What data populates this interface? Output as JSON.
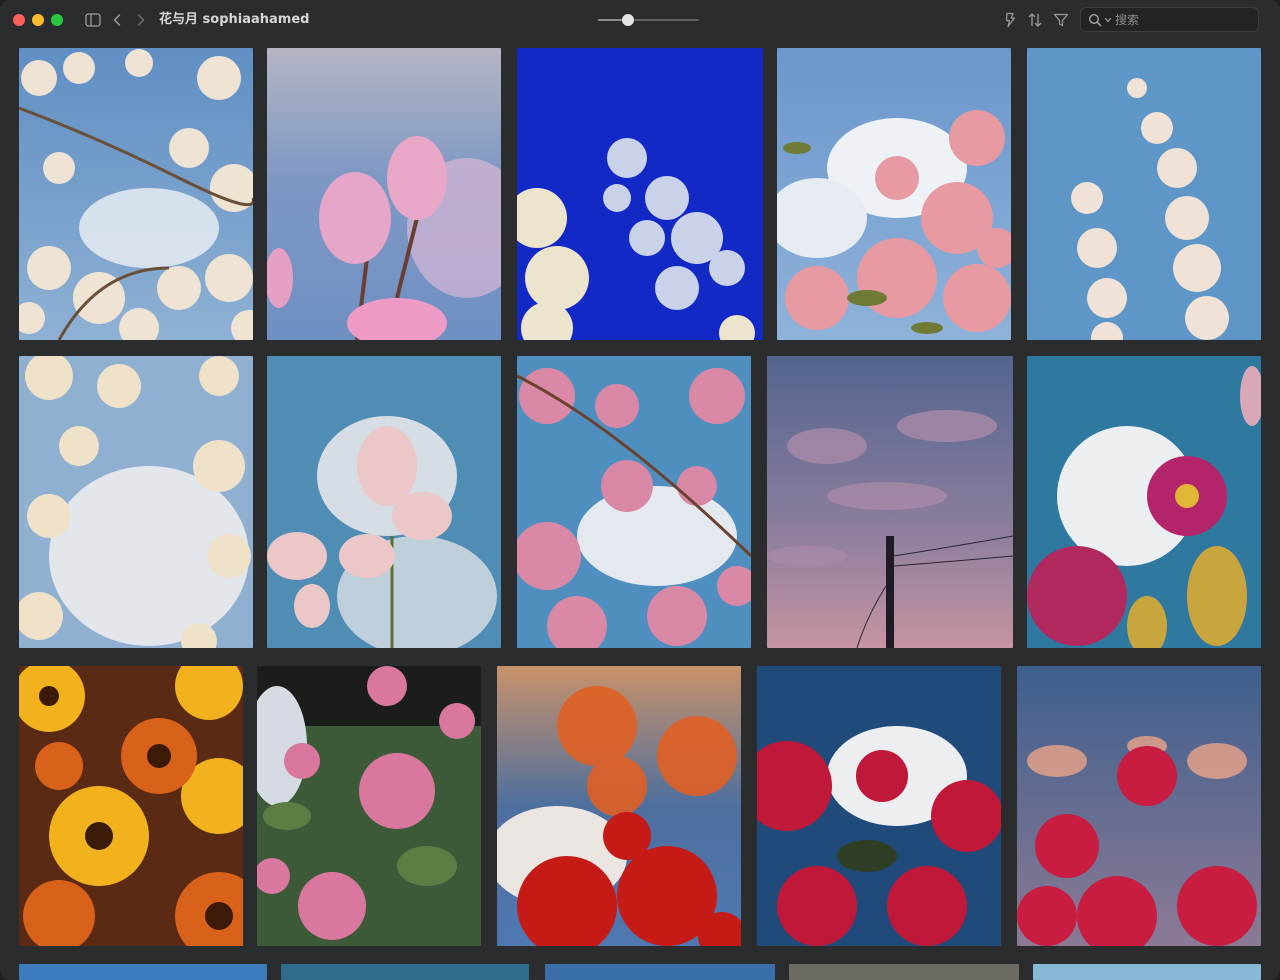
{
  "window": {
    "title": "花与月 sophiaahamed"
  },
  "toolbar": {
    "sidebar_icon": "sidebar-toggle-icon",
    "back_icon": "chevron-left-icon",
    "forward_icon": "chevron-right-icon",
    "zoom_level": 0.3,
    "quick_actions_icon": "lightning-icon",
    "sort_icon": "sort-arrows-icon",
    "filter_icon": "funnel-icon",
    "search": {
      "placeholder": "搜索",
      "value": ""
    }
  },
  "photos": [
    {
      "subject": "white cherry blossom branches against blue sky with cloud"
    },
    {
      "subject": "pink magnolia buds against cloudy sky"
    },
    {
      "subject": "white blossoms against deep blue sky"
    },
    {
      "subject": "pink flowering tree with large white cloud"
    },
    {
      "subject": "hanging white blossom strands against blue sky"
    },
    {
      "subject": "white blossoms in front of soft cloud"
    },
    {
      "subject": "pink magnolia against teal sky and clouds"
    },
    {
      "subject": "pink cherry blossom branches with clouds"
    },
    {
      "subject": "dusky pink clouds with utility pole and wires"
    },
    {
      "subject": "magenta dahlias beneath white cloud"
    },
    {
      "subject": "orange and yellow sunflowers"
    },
    {
      "subject": "pink roses on bush"
    },
    {
      "subject": "red and orange flowers with warm sunset cloud"
    },
    {
      "subject": "red roses with white cloud in dark blue sky"
    },
    {
      "subject": "red roses against pink sunset sky"
    },
    {
      "subject": "blue sky"
    },
    {
      "subject": "teal sky"
    },
    {
      "subject": "blue sky"
    },
    {
      "subject": "grey branches"
    },
    {
      "subject": "pale blue sky"
    }
  ],
  "colors": {
    "background": "#2b2c2e",
    "close": "#ff5f57",
    "minimize": "#febc2e",
    "maximize": "#28c840"
  }
}
